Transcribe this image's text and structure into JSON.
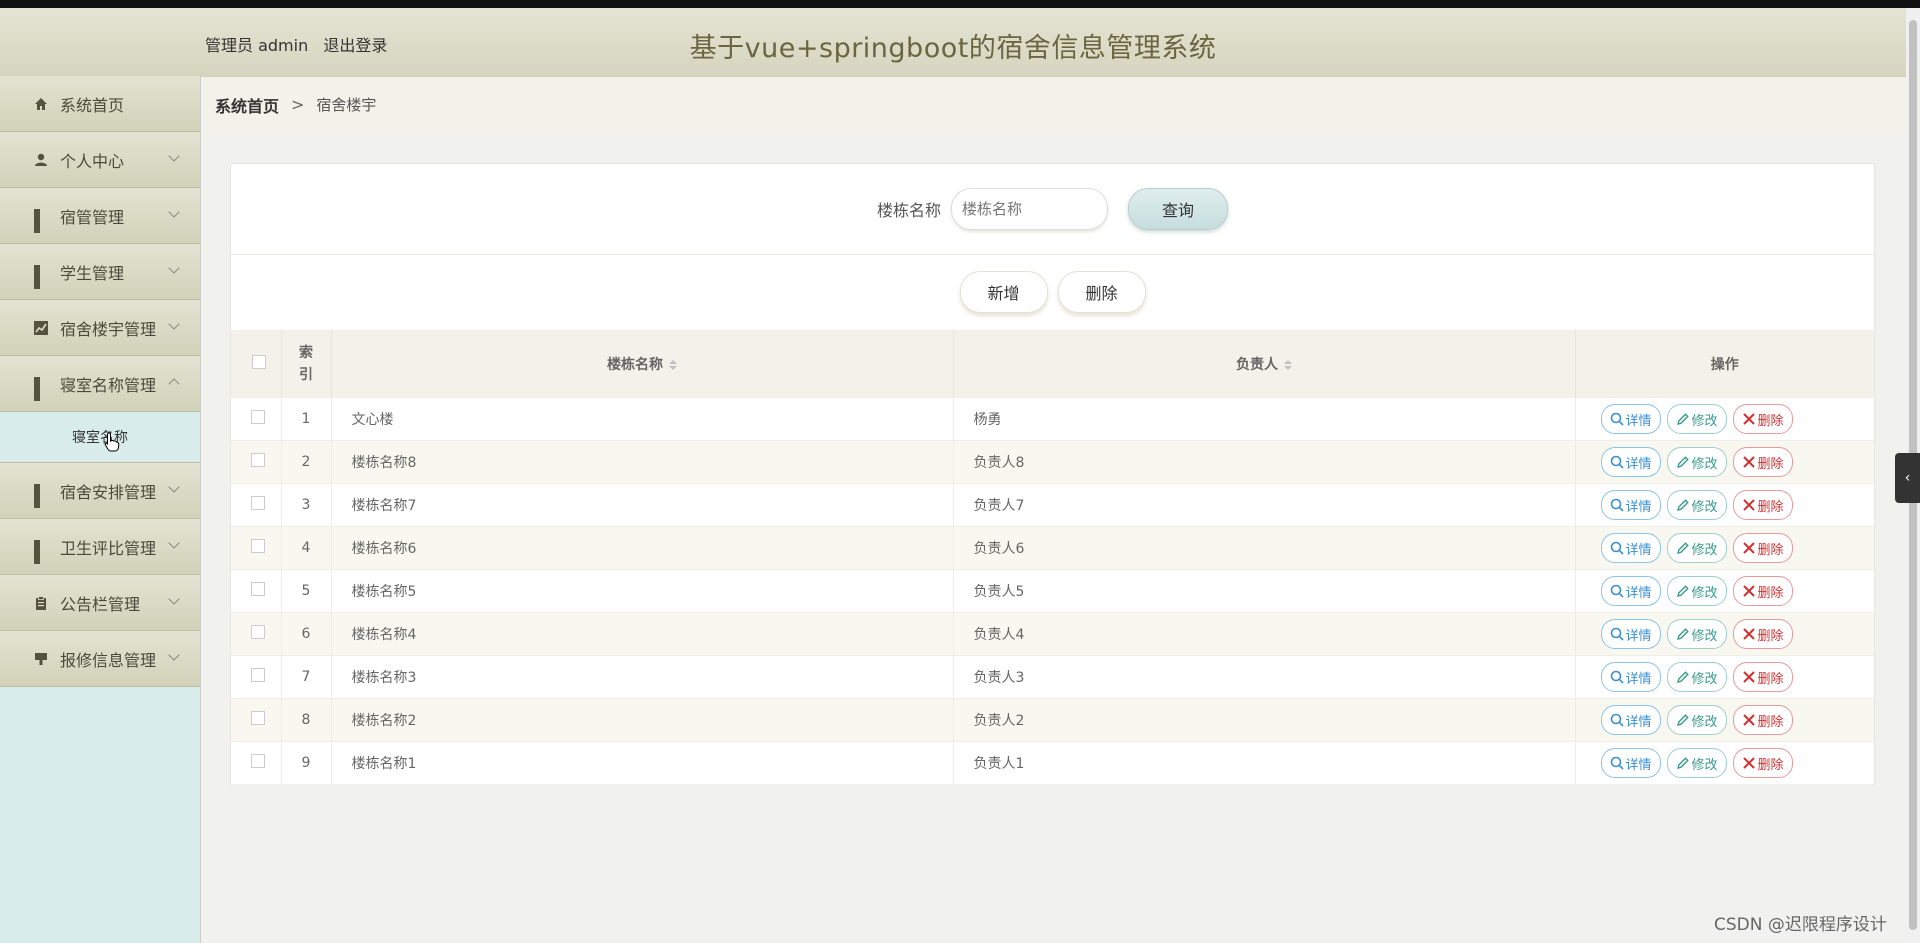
{
  "header": {
    "user_label": "管理员 admin",
    "logout_label": "退出登录",
    "title": "基于vue+springboot的宿舍信息管理系统"
  },
  "sidebar": {
    "items": [
      {
        "label": "系统首页",
        "icon": "home-icon"
      },
      {
        "label": "个人中心",
        "icon": "user-icon"
      },
      {
        "label": "宿管管理",
        "icon": "grid-icon"
      },
      {
        "label": "学生管理",
        "icon": "grid-icon"
      },
      {
        "label": "宿舍楼宇管理",
        "icon": "chart-icon"
      },
      {
        "label": "寝室名称管理",
        "icon": "grid-icon"
      },
      {
        "label": "宿舍安排管理",
        "icon": "grid-icon"
      },
      {
        "label": "卫生评比管理",
        "icon": "grid-icon"
      },
      {
        "label": "公告栏管理",
        "icon": "clipboard-icon"
      },
      {
        "label": "报修信息管理",
        "icon": "stamp-icon"
      }
    ],
    "submenu": {
      "label": "寝室名称"
    }
  },
  "breadcrumb": {
    "home": "系统首页",
    "separator": ">",
    "current": "宿舍楼宇"
  },
  "search": {
    "label": "楼栋名称",
    "placeholder": "楼栋名称",
    "query_label": "查询"
  },
  "actions": {
    "add_label": "新增",
    "delete_label": "删除"
  },
  "table": {
    "headers": {
      "index": "索引",
      "name": "楼栋名称",
      "manager": "负责人",
      "ops": "操作"
    },
    "rows": [
      {
        "index": "1",
        "name": "文心楼",
        "manager": "杨勇"
      },
      {
        "index": "2",
        "name": "楼栋名称8",
        "manager": "负责人8"
      },
      {
        "index": "3",
        "name": "楼栋名称7",
        "manager": "负责人7"
      },
      {
        "index": "4",
        "name": "楼栋名称6",
        "manager": "负责人6"
      },
      {
        "index": "5",
        "name": "楼栋名称5",
        "manager": "负责人5"
      },
      {
        "index": "6",
        "name": "楼栋名称4",
        "manager": "负责人4"
      },
      {
        "index": "7",
        "name": "楼栋名称3",
        "manager": "负责人3"
      },
      {
        "index": "8",
        "name": "楼栋名称2",
        "manager": "负责人2"
      },
      {
        "index": "9",
        "name": "楼栋名称1",
        "manager": "负责人1"
      }
    ],
    "op_labels": {
      "detail": "详情",
      "edit": "修改",
      "delete": "删除"
    }
  },
  "watermark": "CSDN @迟限程序设计",
  "colors": {
    "header_title": "#6b6640",
    "sidebar_bg": "#d9ecec",
    "delete_red": "#d23030",
    "detail_blue": "#3a8fd0"
  }
}
